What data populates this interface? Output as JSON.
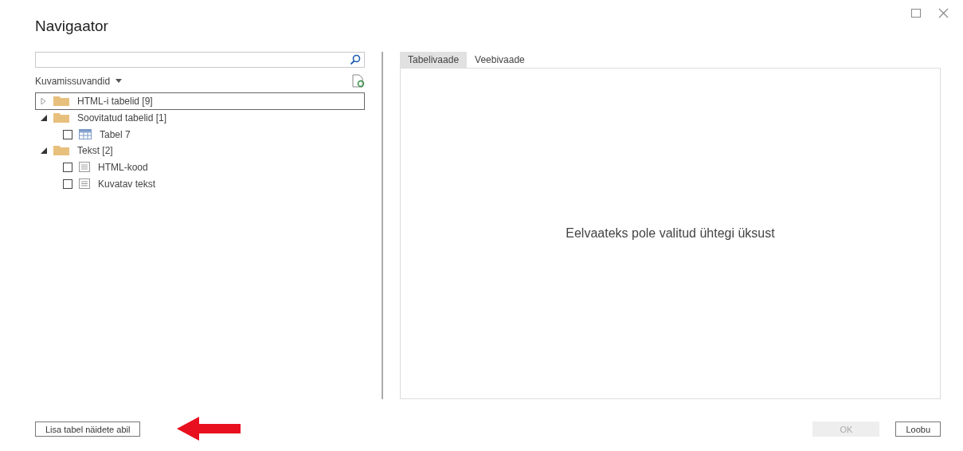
{
  "window": {
    "title": "Navigaator"
  },
  "display_options": {
    "label": "Kuvamissuvandid"
  },
  "tree": [
    {
      "label": "HTML-i tabelid [9]",
      "kind": "folder",
      "expanded": false,
      "selected": true
    },
    {
      "label": "Soovitatud tabelid [1]",
      "kind": "folder",
      "expanded": true,
      "selected": false,
      "children": [
        {
          "label": "Tabel 7",
          "kind": "table",
          "checked": false,
          "selected": false
        }
      ]
    },
    {
      "label": "Tekst [2]",
      "kind": "folder",
      "expanded": true,
      "selected": false,
      "children": [
        {
          "label": "HTML-kood",
          "kind": "text",
          "checked": false,
          "selected": false
        },
        {
          "label": "Kuvatav tekst",
          "kind": "text",
          "checked": false,
          "selected": false
        }
      ]
    }
  ],
  "tabs": [
    {
      "label": "Tabelivaade",
      "selected": true
    },
    {
      "label": "Veebivaade",
      "selected": false
    }
  ],
  "preview": {
    "message": "Eelvaateks pole valitud ühtegi üksust"
  },
  "footer": {
    "example_button": "Lisa tabel näidete abil",
    "ok": {
      "label": "OK",
      "disabled": true
    },
    "cancel": "Loobu"
  }
}
